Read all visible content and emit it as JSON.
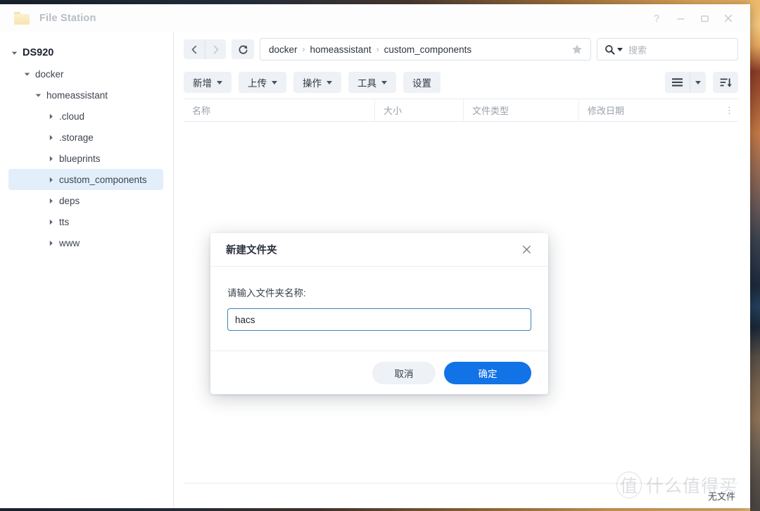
{
  "window": {
    "app_title": "File Station",
    "app_icon": "folder-icon",
    "controls": {
      "help": "?",
      "minimize": "minimize-icon",
      "maximize": "maximize-icon",
      "close": "close-icon"
    }
  },
  "sidebar": {
    "items": [
      {
        "label": "DS920",
        "depth": 0,
        "expanded": true,
        "selected": false
      },
      {
        "label": "docker",
        "depth": 1,
        "expanded": true,
        "selected": false
      },
      {
        "label": "homeassistant",
        "depth": 2,
        "expanded": true,
        "selected": false
      },
      {
        "label": ".cloud",
        "depth": 3,
        "expanded": false,
        "selected": false
      },
      {
        "label": ".storage",
        "depth": 3,
        "expanded": false,
        "selected": false
      },
      {
        "label": "blueprints",
        "depth": 3,
        "expanded": false,
        "selected": false
      },
      {
        "label": "custom_components",
        "depth": 3,
        "expanded": false,
        "selected": true
      },
      {
        "label": "deps",
        "depth": 3,
        "expanded": false,
        "selected": false
      },
      {
        "label": "tts",
        "depth": 3,
        "expanded": false,
        "selected": false
      },
      {
        "label": "www",
        "depth": 3,
        "expanded": false,
        "selected": false
      }
    ]
  },
  "nav": {
    "back": "back-icon",
    "forward": "forward-icon",
    "refresh": "refresh-icon",
    "breadcrumbs": [
      "docker",
      "homeassistant",
      "custom_components"
    ],
    "breadcrumb_separator": "›",
    "favorite": "star-icon"
  },
  "search": {
    "icon": "search-icon",
    "placeholder": "搜索",
    "value": ""
  },
  "toolbar": {
    "buttons": [
      {
        "label": "新增",
        "has_caret": true
      },
      {
        "label": "上传",
        "has_caret": true
      },
      {
        "label": "操作",
        "has_caret": true
      },
      {
        "label": "工具",
        "has_caret": true
      },
      {
        "label": "设置",
        "has_caret": false
      }
    ],
    "view_mode": "list-view-icon",
    "view_caret": "chevron-down-icon",
    "sort": "sort-descending-icon"
  },
  "filelist": {
    "columns": [
      "名称",
      "大小",
      "文件类型",
      "修改日期"
    ],
    "column_menu": "⋮",
    "rows": [],
    "status": "无文件"
  },
  "dialog": {
    "title": "新建文件夹",
    "close": "close-icon",
    "field_label": "请输入文件夹名称:",
    "input_value": "hacs",
    "input_placeholder": "",
    "cancel_label": "取消",
    "confirm_label": "确定"
  },
  "watermark": {
    "circle": "值",
    "text": "什么值得买"
  },
  "colors": {
    "accent": "#1273e6",
    "selection": "#e3eefb",
    "toolbar_button": "#eef1f5",
    "input_focus_border": "#3f85b0"
  }
}
